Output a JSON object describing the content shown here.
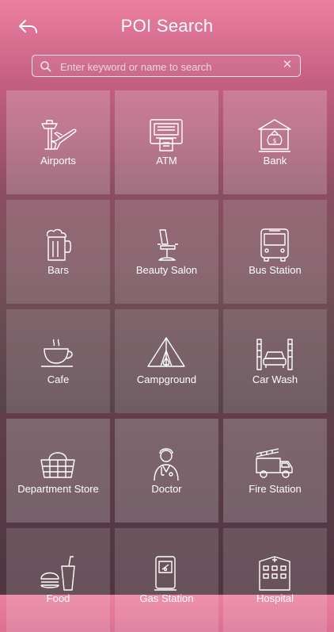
{
  "header": {
    "title": "POI Search",
    "back_icon": "back-arrow-icon"
  },
  "search": {
    "placeholder": "Enter keyword or name to search",
    "value": ""
  },
  "categories": [
    {
      "label": "Airports",
      "icon": "airport-icon"
    },
    {
      "label": "ATM",
      "icon": "atm-icon"
    },
    {
      "label": "Bank",
      "icon": "bank-icon"
    },
    {
      "label": "Bars",
      "icon": "beer-mug-icon"
    },
    {
      "label": "Beauty Salon",
      "icon": "salon-chair-icon"
    },
    {
      "label": "Bus Station",
      "icon": "bus-icon"
    },
    {
      "label": "Cafe",
      "icon": "coffee-cup-icon"
    },
    {
      "label": "Campground",
      "icon": "tent-icon"
    },
    {
      "label": "Car Wash",
      "icon": "car-wash-icon"
    },
    {
      "label": "Department Store",
      "icon": "shopping-basket-icon"
    },
    {
      "label": "Doctor",
      "icon": "doctor-icon"
    },
    {
      "label": "Fire Station",
      "icon": "fire-truck-icon"
    },
    {
      "label": "Food",
      "icon": "food-icon"
    },
    {
      "label": "Gas Station",
      "icon": "gas-pump-icon"
    },
    {
      "label": "Hospital",
      "icon": "hospital-icon"
    }
  ]
}
